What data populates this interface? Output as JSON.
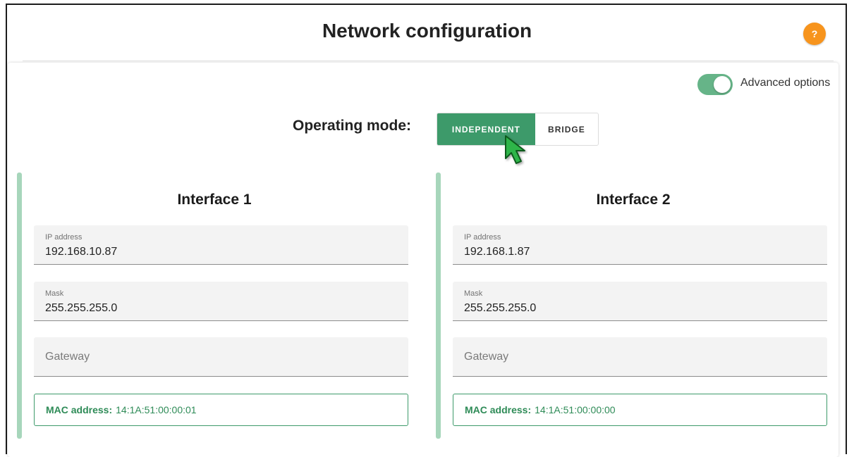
{
  "header": {
    "title": "Network configuration",
    "help_label": "?"
  },
  "advanced": {
    "label": "Advanced options",
    "enabled": true
  },
  "operating_mode": {
    "label": "Operating mode:",
    "options": [
      "INDEPENDENT",
      "BRIDGE"
    ],
    "selected": "INDEPENDENT"
  },
  "interfaces": [
    {
      "title": "Interface 1",
      "ip_label": "IP address",
      "ip_value": "192.168.10.87",
      "mask_label": "Mask",
      "mask_value": "255.255.255.0",
      "gateway_placeholder": "Gateway",
      "mac_label": "MAC address:",
      "mac_value": "14:1A:51:00:00:01"
    },
    {
      "title": "Interface 2",
      "ip_label": "IP address",
      "ip_value": "192.168.1.87",
      "mask_label": "Mask",
      "mask_value": "255.255.255.0",
      "gateway_placeholder": "Gateway",
      "mac_label": "MAC address:",
      "mac_value": "14:1A:51:00:00:00"
    }
  ],
  "colors": {
    "accent": "#3d9a6a",
    "toggle": "#66b488",
    "help": "#f7941d",
    "interface_bar": "#a7d6bb"
  },
  "icons": {
    "help": "question-icon",
    "cursor": "arrow-cursor-icon"
  }
}
